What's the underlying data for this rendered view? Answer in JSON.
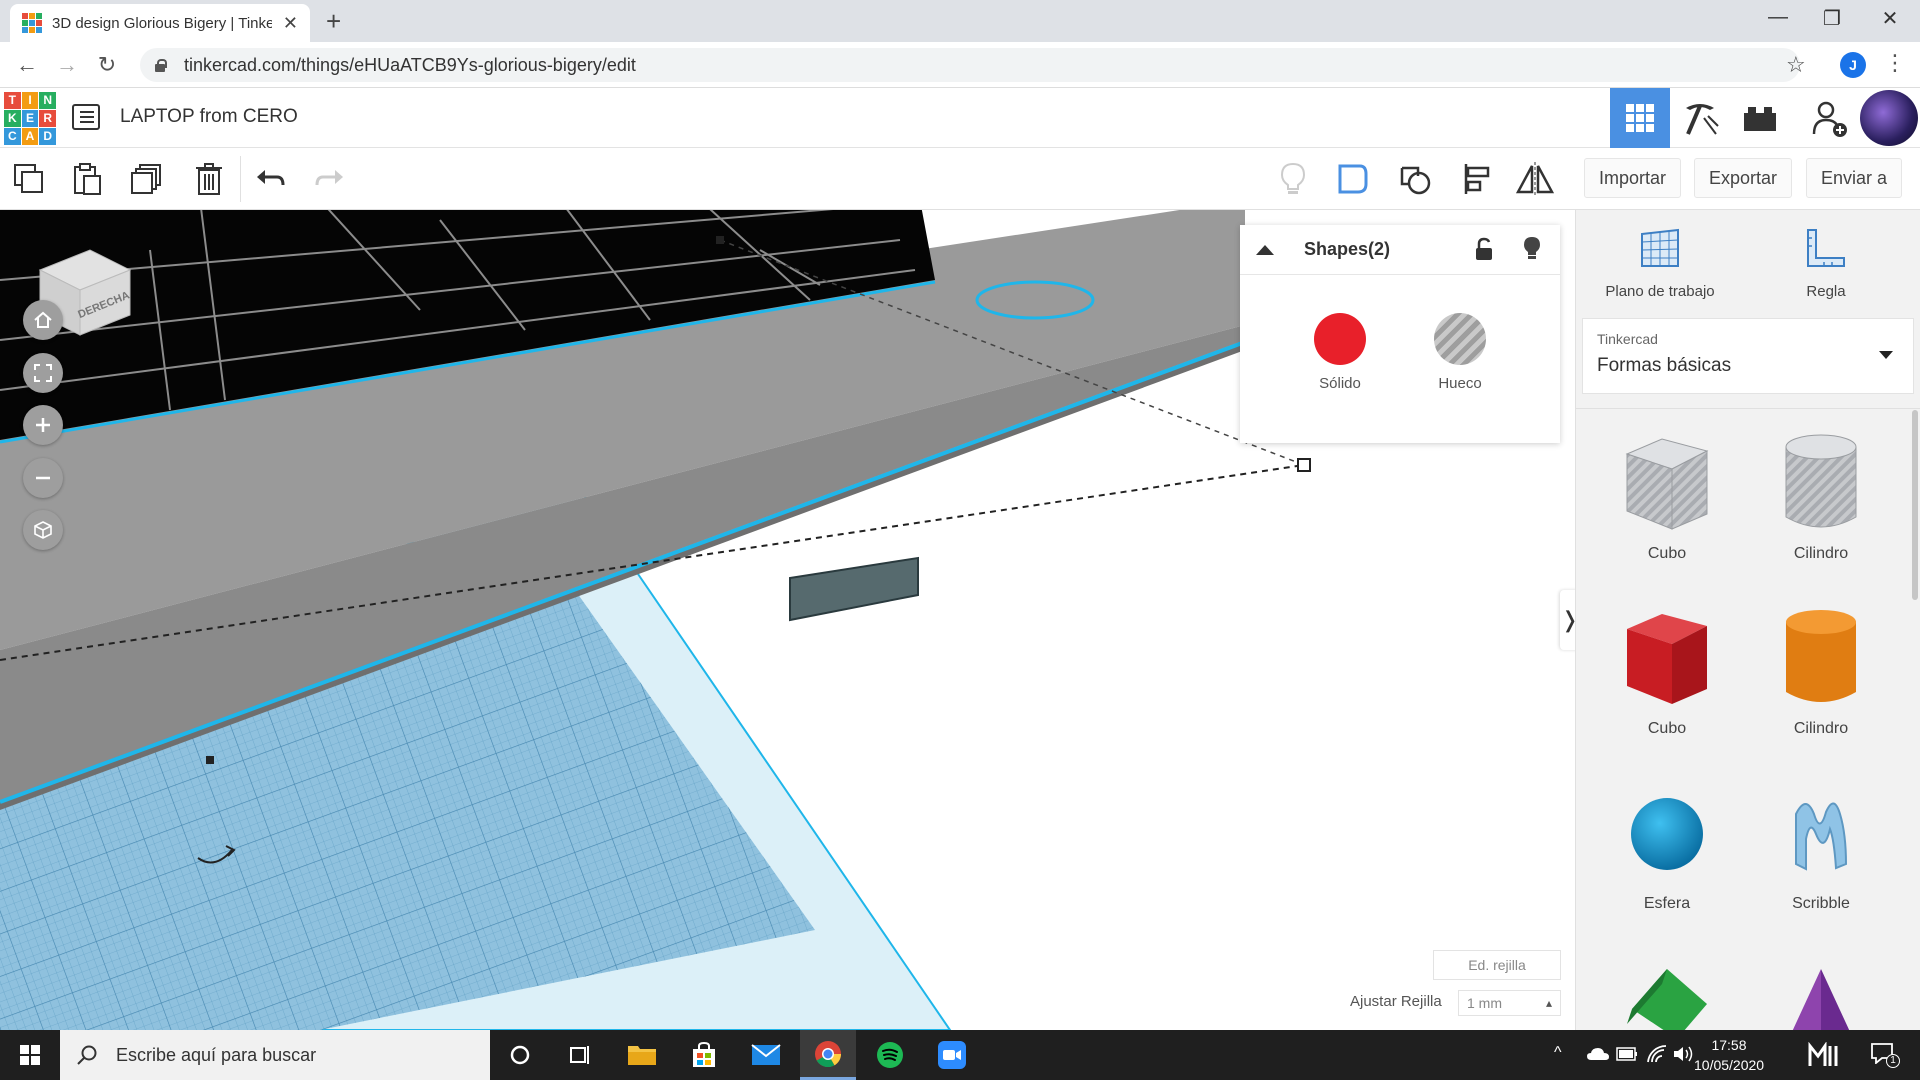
{
  "browser": {
    "tab_title": "3D design Glorious Bigery | Tinkercad",
    "tab_close": "✕",
    "new_tab": "+",
    "url": "tinkercad.com/things/eHUaATCB9Ys-glorious-bigery/edit",
    "profile_initial": "J",
    "window_controls": {
      "minimize": "—",
      "maximize": "❐",
      "close": "✕"
    }
  },
  "header": {
    "logo_letters": [
      "T",
      "I",
      "N",
      "K",
      "E",
      "R",
      "C",
      "A",
      "D"
    ],
    "logo_colors": [
      "#e74c3c",
      "#f39c12",
      "#27ae60",
      "#27ae60",
      "#3498db",
      "#e74c3c",
      "#3498db",
      "#f39c12",
      "#3498db"
    ],
    "project_title": "LAPTOP from CERO"
  },
  "toolbar": {
    "import_label": "Importar",
    "export_label": "Exportar",
    "send_label": "Enviar a"
  },
  "viewcube": {
    "face_label": "DERECHA"
  },
  "inspector": {
    "title": "Shapes(2)",
    "solid_label": "Sólido",
    "hole_label": "Hueco",
    "solid_color": "#e8202a"
  },
  "workplane_footer": {
    "edit_grid": "Ed. rejilla",
    "snap_label": "Ajustar Rejilla",
    "snap_value": "1 mm"
  },
  "right_panel": {
    "workplane_label": "Plano de trabajo",
    "ruler_label": "Regla",
    "library_source": "Tinkercad",
    "library_name": "Formas básicas",
    "shapes": [
      {
        "label": "Cubo",
        "kind": "hole-box"
      },
      {
        "label": "Cilindro",
        "kind": "hole-cylinder"
      },
      {
        "label": "Cubo",
        "kind": "box"
      },
      {
        "label": "Cilindro",
        "kind": "cylinder"
      },
      {
        "label": "Esfera",
        "kind": "sphere"
      },
      {
        "label": "Scribble",
        "kind": "scribble"
      }
    ]
  },
  "taskbar": {
    "search_placeholder": "Escribe aquí para buscar",
    "time": "17:58",
    "date": "10/05/2020",
    "notification_count": "1"
  },
  "colors": {
    "accent": "#4a90e2",
    "grid_blue": "#7db7d8",
    "laptop_gray": "#8a8a8a",
    "selection_cyan": "#1fb6ea"
  }
}
